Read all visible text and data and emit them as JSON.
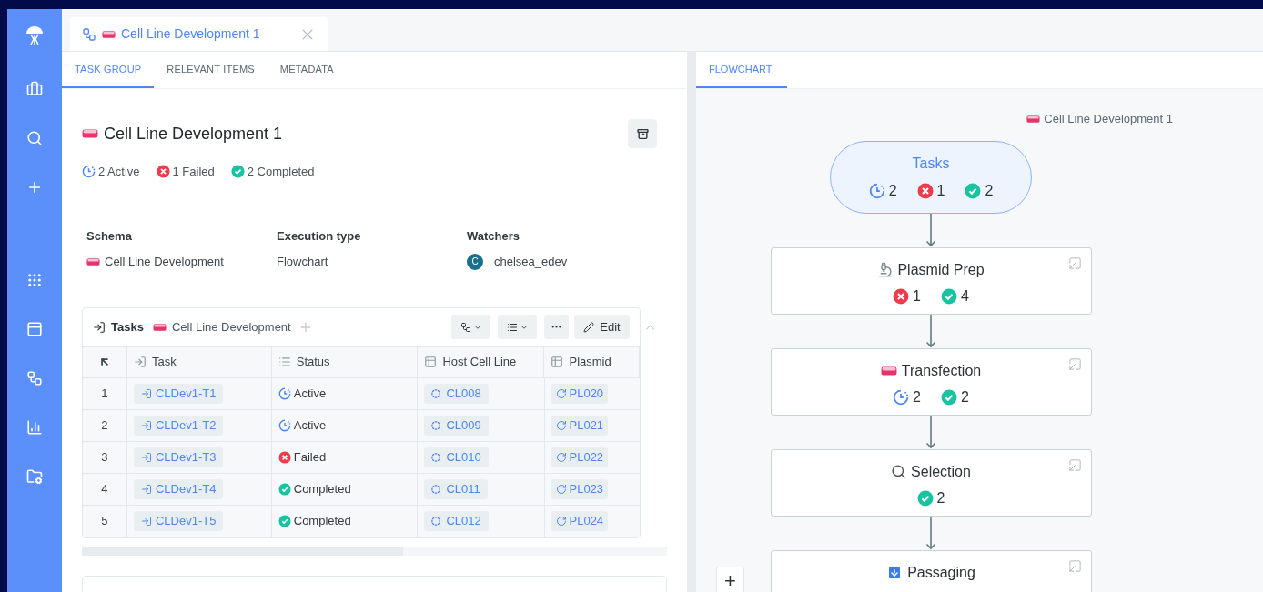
{
  "document_tab": {
    "title": "Cell Line Development 1"
  },
  "left_tabs": [
    {
      "label": "TASK GROUP",
      "selected": true
    },
    {
      "label": "RELEVANT ITEMS",
      "selected": false
    },
    {
      "label": "METADATA",
      "selected": false
    }
  ],
  "header": {
    "title": "Cell Line Development 1"
  },
  "summary": [
    {
      "kind": "active",
      "text": "2 Active"
    },
    {
      "kind": "failed",
      "text": "1 Failed"
    },
    {
      "kind": "completed",
      "text": "2 Completed"
    }
  ],
  "fields": [
    {
      "label": "Schema",
      "value": "Cell Line Development",
      "kind": "schema"
    },
    {
      "label": "Execution type",
      "value": "Flowchart",
      "kind": "plain"
    },
    {
      "label": "Watchers",
      "value": "chelsea_edev",
      "kind": "user",
      "avatar": "C"
    }
  ],
  "tasks_table": {
    "title": "Tasks",
    "schema": "Cell Line Development",
    "edit_label": "Edit",
    "columns": [
      "Task",
      "Status",
      "Host Cell Line",
      "Plasmid"
    ],
    "rows": [
      {
        "index": "1",
        "task": "CLDev1-T1",
        "status": "Active",
        "kind": "active",
        "host": "CL008",
        "plasmid": "PL020"
      },
      {
        "index": "2",
        "task": "CLDev1-T2",
        "status": "Active",
        "kind": "active",
        "host": "CL009",
        "plasmid": "PL021"
      },
      {
        "index": "3",
        "task": "CLDev1-T3",
        "status": "Failed",
        "kind": "failed",
        "host": "CL010",
        "plasmid": "PL022"
      },
      {
        "index": "4",
        "task": "CLDev1-T4",
        "status": "Completed",
        "kind": "completed",
        "host": "CL011",
        "plasmid": "PL023"
      },
      {
        "index": "5",
        "task": "CLDev1-T5",
        "status": "Completed",
        "kind": "completed",
        "host": "CL012",
        "plasmid": "PL024"
      }
    ]
  },
  "right_tabs": [
    {
      "label": "FLOWCHART",
      "selected": true
    }
  ],
  "flowchart": {
    "title": "Cell Line Development 1",
    "start": {
      "label": "Tasks",
      "counts": [
        {
          "kind": "active",
          "count": "2"
        },
        {
          "kind": "failed",
          "count": "1"
        },
        {
          "kind": "completed",
          "count": "2"
        }
      ]
    },
    "nodes": [
      {
        "label": "Plasmid Prep",
        "counts": [
          {
            "kind": "failed",
            "count": "1"
          },
          {
            "kind": "completed",
            "count": "4"
          }
        ]
      },
      {
        "label": "Transfection",
        "counts": [
          {
            "kind": "active",
            "count": "2"
          },
          {
            "kind": "completed",
            "count": "2"
          }
        ]
      },
      {
        "label": "Selection",
        "counts": [
          {
            "kind": "completed",
            "count": "2"
          }
        ]
      },
      {
        "label": "Passaging"
      }
    ]
  },
  "zoom_control": {
    "label": "+"
  }
}
